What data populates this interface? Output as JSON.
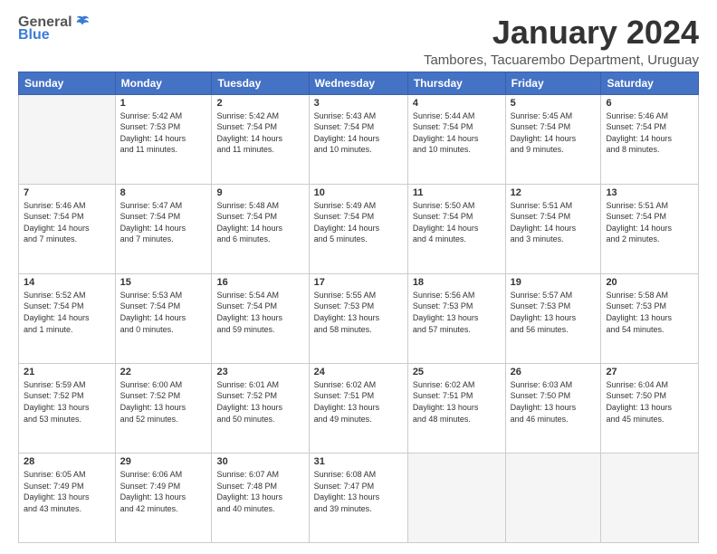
{
  "logo": {
    "general": "General",
    "blue": "Blue"
  },
  "title": "January 2024",
  "location": "Tambores, Tacuarembo Department, Uruguay",
  "headers": [
    "Sunday",
    "Monday",
    "Tuesday",
    "Wednesday",
    "Thursday",
    "Friday",
    "Saturday"
  ],
  "weeks": [
    [
      {
        "day": "",
        "info": ""
      },
      {
        "day": "1",
        "info": "Sunrise: 5:42 AM\nSunset: 7:53 PM\nDaylight: 14 hours\nand 11 minutes."
      },
      {
        "day": "2",
        "info": "Sunrise: 5:42 AM\nSunset: 7:54 PM\nDaylight: 14 hours\nand 11 minutes."
      },
      {
        "day": "3",
        "info": "Sunrise: 5:43 AM\nSunset: 7:54 PM\nDaylight: 14 hours\nand 10 minutes."
      },
      {
        "day": "4",
        "info": "Sunrise: 5:44 AM\nSunset: 7:54 PM\nDaylight: 14 hours\nand 10 minutes."
      },
      {
        "day": "5",
        "info": "Sunrise: 5:45 AM\nSunset: 7:54 PM\nDaylight: 14 hours\nand 9 minutes."
      },
      {
        "day": "6",
        "info": "Sunrise: 5:46 AM\nSunset: 7:54 PM\nDaylight: 14 hours\nand 8 minutes."
      }
    ],
    [
      {
        "day": "7",
        "info": "Sunrise: 5:46 AM\nSunset: 7:54 PM\nDaylight: 14 hours\nand 7 minutes."
      },
      {
        "day": "8",
        "info": "Sunrise: 5:47 AM\nSunset: 7:54 PM\nDaylight: 14 hours\nand 7 minutes."
      },
      {
        "day": "9",
        "info": "Sunrise: 5:48 AM\nSunset: 7:54 PM\nDaylight: 14 hours\nand 6 minutes."
      },
      {
        "day": "10",
        "info": "Sunrise: 5:49 AM\nSunset: 7:54 PM\nDaylight: 14 hours\nand 5 minutes."
      },
      {
        "day": "11",
        "info": "Sunrise: 5:50 AM\nSunset: 7:54 PM\nDaylight: 14 hours\nand 4 minutes."
      },
      {
        "day": "12",
        "info": "Sunrise: 5:51 AM\nSunset: 7:54 PM\nDaylight: 14 hours\nand 3 minutes."
      },
      {
        "day": "13",
        "info": "Sunrise: 5:51 AM\nSunset: 7:54 PM\nDaylight: 14 hours\nand 2 minutes."
      }
    ],
    [
      {
        "day": "14",
        "info": "Sunrise: 5:52 AM\nSunset: 7:54 PM\nDaylight: 14 hours\nand 1 minute."
      },
      {
        "day": "15",
        "info": "Sunrise: 5:53 AM\nSunset: 7:54 PM\nDaylight: 14 hours\nand 0 minutes."
      },
      {
        "day": "16",
        "info": "Sunrise: 5:54 AM\nSunset: 7:54 PM\nDaylight: 13 hours\nand 59 minutes."
      },
      {
        "day": "17",
        "info": "Sunrise: 5:55 AM\nSunset: 7:53 PM\nDaylight: 13 hours\nand 58 minutes."
      },
      {
        "day": "18",
        "info": "Sunrise: 5:56 AM\nSunset: 7:53 PM\nDaylight: 13 hours\nand 57 minutes."
      },
      {
        "day": "19",
        "info": "Sunrise: 5:57 AM\nSunset: 7:53 PM\nDaylight: 13 hours\nand 56 minutes."
      },
      {
        "day": "20",
        "info": "Sunrise: 5:58 AM\nSunset: 7:53 PM\nDaylight: 13 hours\nand 54 minutes."
      }
    ],
    [
      {
        "day": "21",
        "info": "Sunrise: 5:59 AM\nSunset: 7:52 PM\nDaylight: 13 hours\nand 53 minutes."
      },
      {
        "day": "22",
        "info": "Sunrise: 6:00 AM\nSunset: 7:52 PM\nDaylight: 13 hours\nand 52 minutes."
      },
      {
        "day": "23",
        "info": "Sunrise: 6:01 AM\nSunset: 7:52 PM\nDaylight: 13 hours\nand 50 minutes."
      },
      {
        "day": "24",
        "info": "Sunrise: 6:02 AM\nSunset: 7:51 PM\nDaylight: 13 hours\nand 49 minutes."
      },
      {
        "day": "25",
        "info": "Sunrise: 6:02 AM\nSunset: 7:51 PM\nDaylight: 13 hours\nand 48 minutes."
      },
      {
        "day": "26",
        "info": "Sunrise: 6:03 AM\nSunset: 7:50 PM\nDaylight: 13 hours\nand 46 minutes."
      },
      {
        "day": "27",
        "info": "Sunrise: 6:04 AM\nSunset: 7:50 PM\nDaylight: 13 hours\nand 45 minutes."
      }
    ],
    [
      {
        "day": "28",
        "info": "Sunrise: 6:05 AM\nSunset: 7:49 PM\nDaylight: 13 hours\nand 43 minutes."
      },
      {
        "day": "29",
        "info": "Sunrise: 6:06 AM\nSunset: 7:49 PM\nDaylight: 13 hours\nand 42 minutes."
      },
      {
        "day": "30",
        "info": "Sunrise: 6:07 AM\nSunset: 7:48 PM\nDaylight: 13 hours\nand 40 minutes."
      },
      {
        "day": "31",
        "info": "Sunrise: 6:08 AM\nSunset: 7:47 PM\nDaylight: 13 hours\nand 39 minutes."
      },
      {
        "day": "",
        "info": ""
      },
      {
        "day": "",
        "info": ""
      },
      {
        "day": "",
        "info": ""
      }
    ]
  ]
}
